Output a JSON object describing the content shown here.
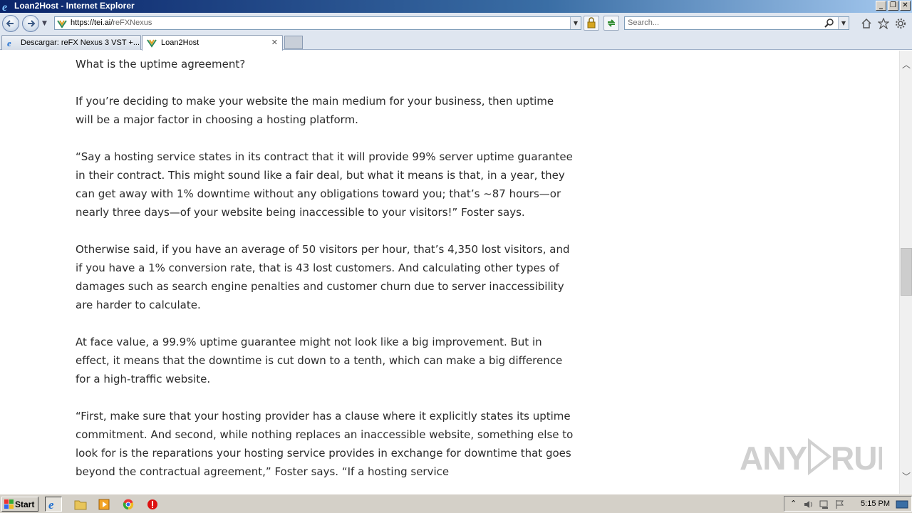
{
  "window": {
    "title": "Loan2Host - Internet Explorer"
  },
  "address_bar": {
    "url_host": "https://tei.ai/",
    "url_path": "reFXNexus"
  },
  "search": {
    "placeholder": "Search..."
  },
  "tabs": [
    {
      "label": "Descargar: reFX Nexus 3 VST +...",
      "active": false
    },
    {
      "label": "Loan2Host",
      "active": true
    }
  ],
  "article": {
    "paragraphs": [
      "What is the uptime agreement?",
      "If you’re deciding to make your website the main medium for your business, then uptime will be a major factor in choosing a hosting platform.",
      "“Say a hosting service states in its contract that it will provide 99% server uptime guarantee in their contract. This might sound like a fair deal, but what it means is that, in a year, they can get away with 1% downtime without any obligations toward you; that’s ~87 hours—or nearly three days—of your website being inaccessible to your visitors!” Foster says.",
      "Otherwise said, if you have an average of 50 visitors per hour, that’s 4,350 lost visitors, and if you have a 1% conversion rate, that is 43 lost customers. And calculating other types of damages such as search engine penalties and customer churn due to server inaccessibility are harder to calculate.",
      "At face value, a 99.9% uptime guarantee might not look like a big improvement. But in effect, it means that the downtime is cut down to a tenth, which can make a big difference for a high-traffic website.",
      "“First, make sure that your hosting provider has a clause where it explicitly states its uptime commitment. And second, while nothing replaces an inaccessible website, something else to look for is the reparations your hosting service provides in exchange for downtime that goes beyond the contractual agreement,” Foster says. “If a hosting service"
    ]
  },
  "watermark": {
    "text": "ANY RUN"
  },
  "taskbar": {
    "start_label": "Start",
    "clock": "5:15 PM"
  }
}
